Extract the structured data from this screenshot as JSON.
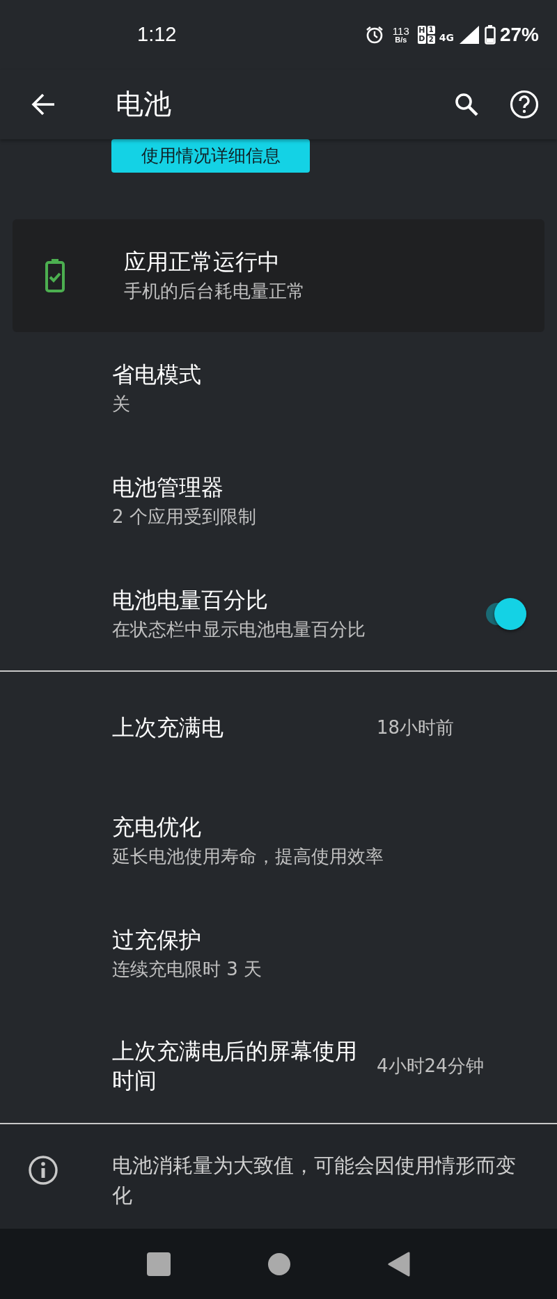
{
  "status_bar": {
    "time": "1:12",
    "net_speed": "113",
    "net_unit": "B/s",
    "hd_label": "HD",
    "sim_labels": [
      "1",
      "2"
    ],
    "network": "4G",
    "battery": "27%"
  },
  "app_bar": {
    "title": "电池"
  },
  "usage_button": {
    "label": "使用情况详细信息"
  },
  "alert_card": {
    "title": "应用正常运行中",
    "subtitle": "手机的后台耗电量正常"
  },
  "settings": [
    {
      "kind": "text",
      "title": "省电模式",
      "subtitle": "关"
    },
    {
      "kind": "text",
      "title": "电池管理器",
      "subtitle": "2 个应用受到限制"
    },
    {
      "kind": "toggle",
      "title": "电池电量百分比",
      "subtitle": "在状态栏中显示电池电量百分比",
      "on": true
    },
    {
      "kind": "divider"
    },
    {
      "kind": "value",
      "title": "上次充满电",
      "value": "18小时前"
    },
    {
      "kind": "text",
      "title": "充电优化",
      "subtitle": "延长电池使用寿命，提高使用效率"
    },
    {
      "kind": "text",
      "title": "过充保护",
      "subtitle": "连续充电限时 3 天"
    },
    {
      "kind": "value",
      "title": "上次充满电后的屏幕使用时间",
      "value": "4小时24分钟"
    }
  ],
  "footer": {
    "note": "电池消耗量为大致值，可能会因使用情形而变化"
  }
}
